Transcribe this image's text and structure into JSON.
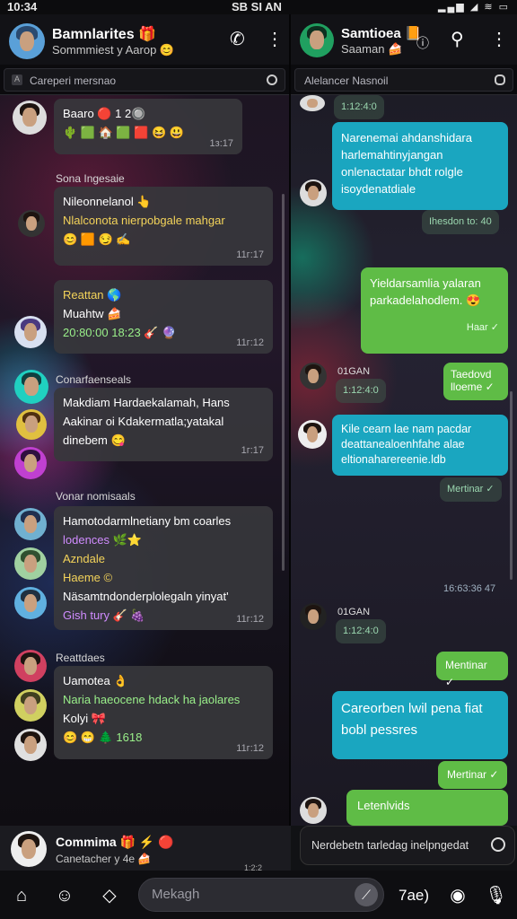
{
  "status": {
    "time": "10:34",
    "center": "SB SI AN",
    "icons": "▂▄▆ ◢ ≋ ▭"
  },
  "left": {
    "header": {
      "title": "Bamnlarites 🎁",
      "subtitle": "Sommmiest y Aarop 😊"
    },
    "search_placeholder": "Careperi mersnao",
    "cards": [
      {
        "lines": [
          "Baaro 🔴 1 2🔘",
          "🌵 🟩 🏠 🟩 🟥 😆 😃"
        ],
        "styles": [
          "",
          "g"
        ],
        "time": "1з:17"
      },
      {
        "section": "Sona Ingesaie",
        "lines": [
          "Nileonnelanol 👆",
          "Nlalconota nierpobgale mahgar",
          "😊 🟧 😏 ✍"
        ],
        "styles": [
          "",
          "y",
          ""
        ],
        "time": "11г:17"
      },
      {
        "lines": [
          "Reattan 🌎",
          "Muahtw 🍰",
          "20:80:00 18:23 🎸 🔮"
        ],
        "styles": [
          "y",
          "",
          "g"
        ],
        "time": "11г:12"
      },
      {
        "section": "Conarfaenseals",
        "lines": [
          "Makdiam Hardaekalamah, Hans",
          "Aakinar oi Kdakermatla;yatakal",
          "dinebem 😋"
        ],
        "styles": [
          "",
          "",
          ""
        ],
        "time": "1г:17"
      },
      {
        "section": "Vonar nomisaals",
        "lines": [
          "Hamotodarmlnetiany bm coarles",
          "lodences 🌿⭐",
          "Azndale",
          "Haeme ©",
          "Näsamtndonderplolegaln yinyat'",
          "Gish tury 🎸 🍇"
        ],
        "styles": [
          "",
          "p",
          "y",
          "y",
          "",
          "p"
        ],
        "time": "11г:12"
      },
      {
        "section": "Reattdaes",
        "lines": [
          "Uamotea 👌",
          "Naria haeocene hdack ha jaolares",
          "Kolyi 🎀",
          "😊 😁 🌲 1618"
        ],
        "styles": [
          "",
          "g",
          "",
          "g"
        ],
        "time": "11г:12"
      }
    ],
    "footer": {
      "title": "Commima 🎁 ⚡ 🔴",
      "subtitle": "Canetacher y 4e 🍰",
      "time": "1:2:2"
    }
  },
  "right": {
    "header": {
      "title": "Samtioea 📙",
      "subtitle": "Saaman 🍰"
    },
    "search_placeholder": "Alelancer Nasnoil",
    "messages": [
      {
        "text": "Narenemai ahdanshidara harlemahtinyjangan onlenactatar bhdt rolgle isoydenatdiale",
        "time": "Ihesdon to: 40",
        "side": "in"
      },
      {
        "text": "Yieldarsamlia yalaran parkadelahodlem. 😍",
        "time": "Haar ✓",
        "side": "out"
      },
      {
        "text": "Taedovd lloeme ✓",
        "time": "",
        "side": "out"
      },
      {
        "text": "Kile cearn lae nam pacdar deattanealoenhfahe alae eltionaharereenie.ldb",
        "time": "Mertinar ✓",
        "side": "in"
      },
      {
        "text": "Mentinar ✓",
        "time": "",
        "side": "out"
      },
      {
        "text": "Careorben lwil pena fiat bobl pessres",
        "time": "Mertinar ✓",
        "side": "in"
      },
      {
        "text": "Letenlvids",
        "time": "",
        "side": "out"
      }
    ],
    "labels": {
      "a": "01GAN",
      "b": "01GAN",
      "day": "16:63:36 47",
      "small_a": "1:12:4:0",
      "small_b": "1:12:4:0"
    },
    "compose_text": "Nerdebetn tarledag inelpngedat"
  },
  "bottom": {
    "placeholder": "Mekagh",
    "label": "7ae)"
  }
}
